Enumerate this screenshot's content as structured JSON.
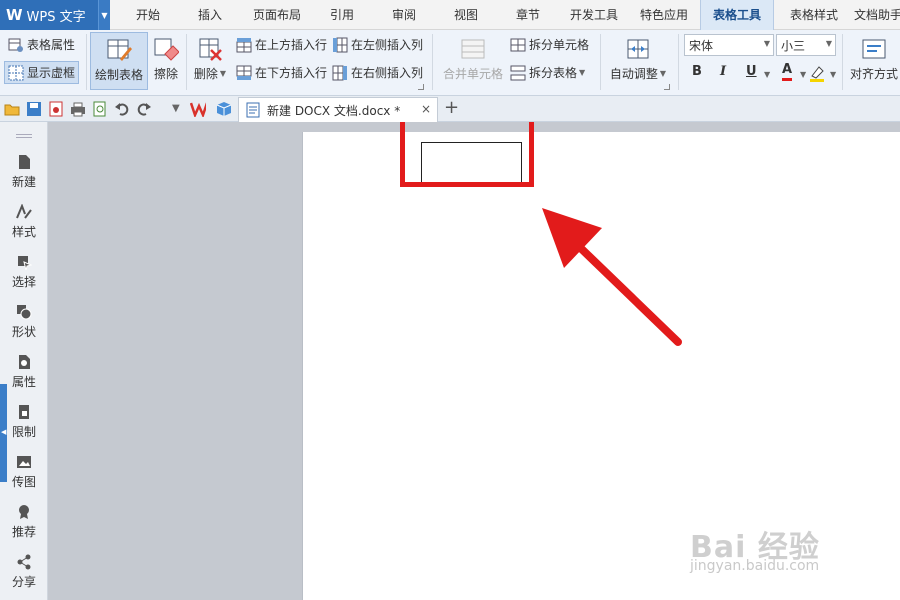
{
  "app": {
    "logo": "W",
    "name": "WPS 文字"
  },
  "menu_tabs": [
    {
      "label": "开始"
    },
    {
      "label": "插入"
    },
    {
      "label": "页面布局"
    },
    {
      "label": "引用"
    },
    {
      "label": "审阅"
    },
    {
      "label": "视图"
    },
    {
      "label": "章节"
    },
    {
      "label": "开发工具"
    },
    {
      "label": "特色应用"
    },
    {
      "label": "表格工具",
      "active": true
    },
    {
      "label": "表格样式"
    },
    {
      "label": "文档助手"
    }
  ],
  "ribbon": {
    "table_props": "表格属性",
    "show_gridlines": "显示虚框",
    "draw_table": "绘制表格",
    "erase": "擦除",
    "delete": "删除",
    "insert_row_above": "在上方插入行",
    "insert_row_below": "在下方插入行",
    "insert_col_left": "在左侧插入列",
    "insert_col_right": "在右侧插入列",
    "merge_cells": "合并单元格",
    "split_cells": "拆分单元格",
    "split_table": "拆分表格",
    "auto_fit": "自动调整",
    "font_name": "宋体",
    "font_size": "小三",
    "bold": "B",
    "italic": "I",
    "underline": "U",
    "font_color": "A",
    "align": "对齐方式"
  },
  "doc_tab": {
    "title": "新建 DOCX 文档.docx *",
    "close": "×",
    "add": "+"
  },
  "side_panel": [
    {
      "label": "新建"
    },
    {
      "label": "样式"
    },
    {
      "label": "选择"
    },
    {
      "label": "形状"
    },
    {
      "label": "属性"
    },
    {
      "label": "限制"
    },
    {
      "label": "传图"
    },
    {
      "label": "推荐"
    },
    {
      "label": "分享"
    }
  ],
  "watermark": {
    "main": "Bai 经验",
    "sub": "jingyan.baidu.com"
  },
  "colors": {
    "accent": "#2f6fb8",
    "highlight": "#e21b1b",
    "active_tab": "#dbe8f6"
  }
}
